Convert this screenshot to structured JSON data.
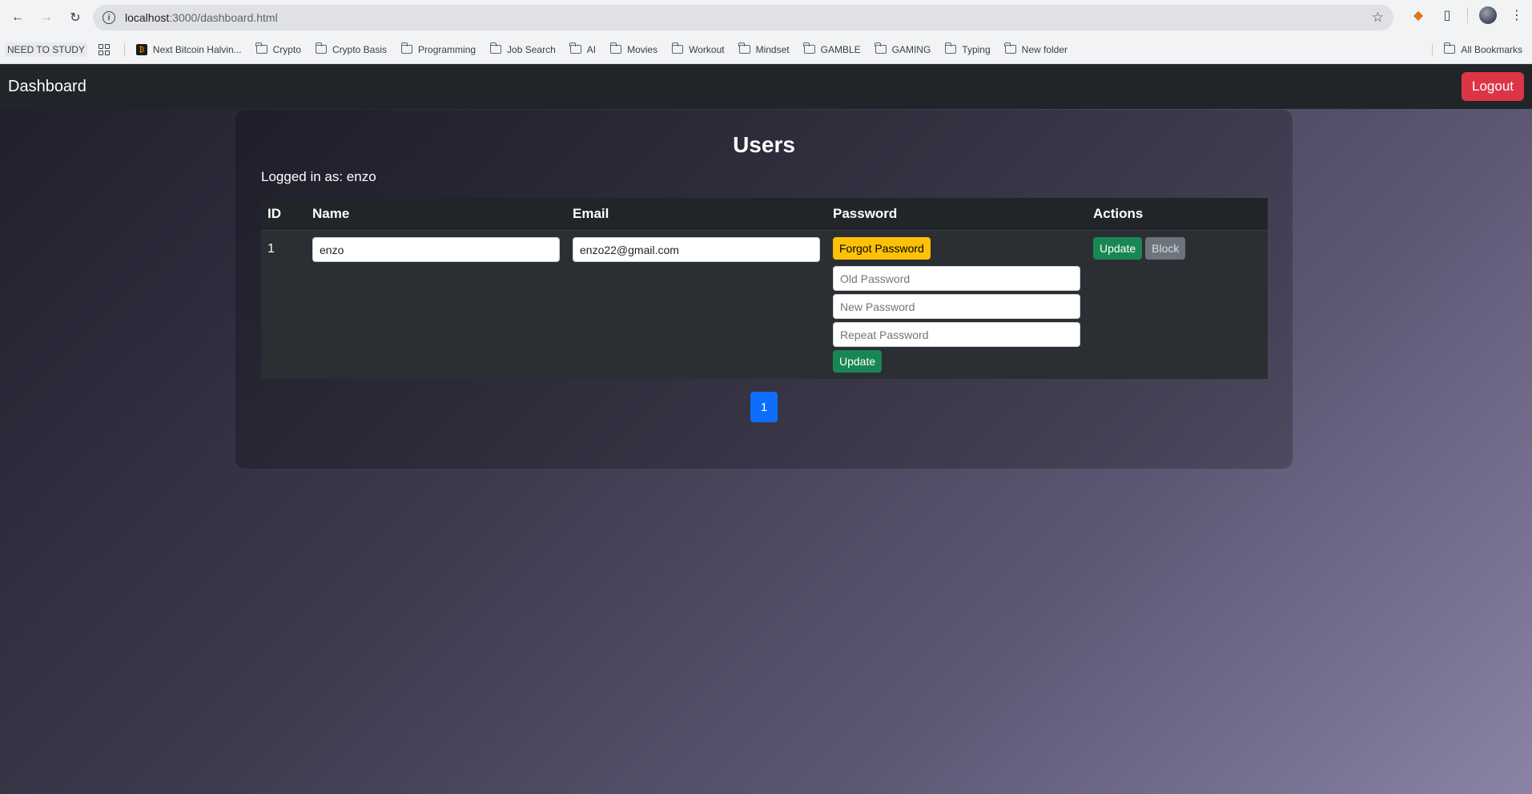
{
  "browser": {
    "url_host": "localhost",
    "url_path": ":3000/dashboard.html",
    "bookmarks": [
      {
        "label": "NEED TO STUDY",
        "kind": "text"
      },
      {
        "label": "Next Bitcoin Halvin...",
        "kind": "site"
      },
      {
        "label": "Crypto",
        "kind": "folder"
      },
      {
        "label": "Crypto Basis",
        "kind": "folder"
      },
      {
        "label": "Programming",
        "kind": "folder"
      },
      {
        "label": "Job Search",
        "kind": "folder"
      },
      {
        "label": "AI",
        "kind": "folder"
      },
      {
        "label": "Movies",
        "kind": "folder"
      },
      {
        "label": "Workout",
        "kind": "folder"
      },
      {
        "label": "Mindset",
        "kind": "folder"
      },
      {
        "label": "GAMBLE",
        "kind": "folder"
      },
      {
        "label": "GAMING",
        "kind": "folder"
      },
      {
        "label": "Typing",
        "kind": "folder"
      },
      {
        "label": "New folder",
        "kind": "folder"
      }
    ],
    "all_bookmarks": "All Bookmarks"
  },
  "navbar": {
    "brand": "Dashboard",
    "logout_label": "Logout"
  },
  "users": {
    "title": "Users",
    "logged_in_as": "Logged in as: enzo",
    "columns": [
      "ID",
      "Name",
      "Email",
      "Password",
      "Actions"
    ],
    "rows": [
      {
        "id": "1",
        "name": "enzo",
        "email": "enzo22@gmail.com",
        "forgot_label": "Forgot Password",
        "old_pw_placeholder": "Old Password",
        "new_pw_placeholder": "New Password",
        "repeat_pw_placeholder": "Repeat Password",
        "pw_update_label": "Update",
        "update_label": "Update",
        "block_label": "Block"
      }
    ],
    "pagination": [
      "1"
    ]
  },
  "colors": {
    "navbar_bg": "#212529",
    "logout": "#dc3545",
    "warning": "#ffc107",
    "success": "#198754",
    "secondary": "#6c757d",
    "primary": "#0d6efd"
  }
}
